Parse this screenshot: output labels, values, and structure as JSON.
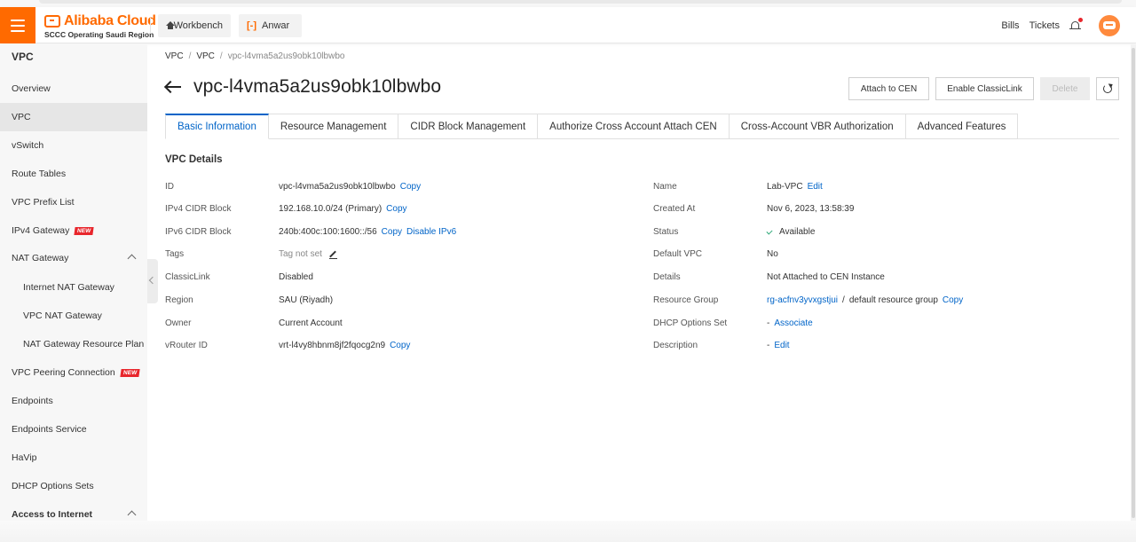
{
  "topbar": {
    "brand_name": "Alibaba Cloud",
    "brand_sub": "SCCC Operating Saudi Region",
    "workbench": "Workbench",
    "user": "Anwar",
    "bills": "Bills",
    "tickets": "Tickets",
    "accent": "#ff6a00"
  },
  "sidebar": {
    "title": "VPC",
    "items": [
      {
        "label": "Overview"
      },
      {
        "label": "VPC"
      },
      {
        "label": "vSwitch"
      },
      {
        "label": "Route Tables"
      },
      {
        "label": "VPC Prefix List"
      },
      {
        "label": "IPv4 Gateway",
        "badge": "NEW"
      },
      {
        "label": "NAT Gateway"
      },
      {
        "label": "Internet NAT Gateway"
      },
      {
        "label": "VPC NAT Gateway"
      },
      {
        "label": "NAT Gateway Resource Plan"
      },
      {
        "label": "VPC Peering Connection",
        "badge": "NEW"
      },
      {
        "label": "Endpoints"
      },
      {
        "label": "Endpoints Service"
      },
      {
        "label": "HaVip"
      },
      {
        "label": "DHCP Options Sets"
      },
      {
        "label": "Access to Internet"
      }
    ]
  },
  "breadcrumb": [
    "VPC",
    "VPC",
    "vpc-l4vma5a2us9obk10lbwbo"
  ],
  "page_title": "vpc-l4vma5a2us9obk10lbwbo",
  "actions": {
    "attach": "Attach to CEN",
    "classic": "Enable ClassicLink",
    "delete": "Delete"
  },
  "tabs": [
    {
      "label": "Basic Information"
    },
    {
      "label": "Resource Management"
    },
    {
      "label": "CIDR Block Management"
    },
    {
      "label": "Authorize Cross Account Attach CEN"
    },
    {
      "label": "Cross-Account VBR Authorization"
    },
    {
      "label": "Advanced Features"
    }
  ],
  "details": {
    "title": "VPC Details",
    "left": {
      "id_label": "ID",
      "id_value": "vpc-l4vma5a2us9obk10lbwbo",
      "ipv4_label": "IPv4 CIDR Block",
      "ipv4_value": "192.168.10.0/24 (Primary)",
      "ipv6_label": "IPv6 CIDR Block",
      "ipv6_value": "240b:400c:100:1600::/56",
      "disable_ipv6": "Disable IPv6",
      "tags_label": "Tags",
      "tags_value": "Tag not set",
      "classiclink_label": "ClassicLink",
      "classiclink_value": "Disabled",
      "region_label": "Region",
      "region_value": "SAU (Riyadh)",
      "owner_label": "Owner",
      "owner_value": "Current Account",
      "vrouter_label": "vRouter ID",
      "vrouter_value": "vrt-l4vy8hbnm8jf2fqocg2n9"
    },
    "right": {
      "name_label": "Name",
      "name_value": "Lab-VPC",
      "created_label": "Created At",
      "created_value": "Nov 6, 2023, 13:58:39",
      "status_label": "Status",
      "status_value": "Available",
      "default_label": "Default VPC",
      "default_value": "No",
      "details_label": "Details",
      "details_value": "Not Attached to CEN Instance",
      "rg_label": "Resource Group",
      "rg_value": "rg-acfnv3yvxgstjui",
      "rg_sep": "/",
      "rg_desc": "default resource group",
      "dhcp_label": "DHCP Options Set",
      "dhcp_dash": "-",
      "dhcp_link": "Associate",
      "desc_label": "Description",
      "desc_dash": "-",
      "desc_link": "Edit"
    },
    "copy": "Copy",
    "edit": "Edit"
  }
}
